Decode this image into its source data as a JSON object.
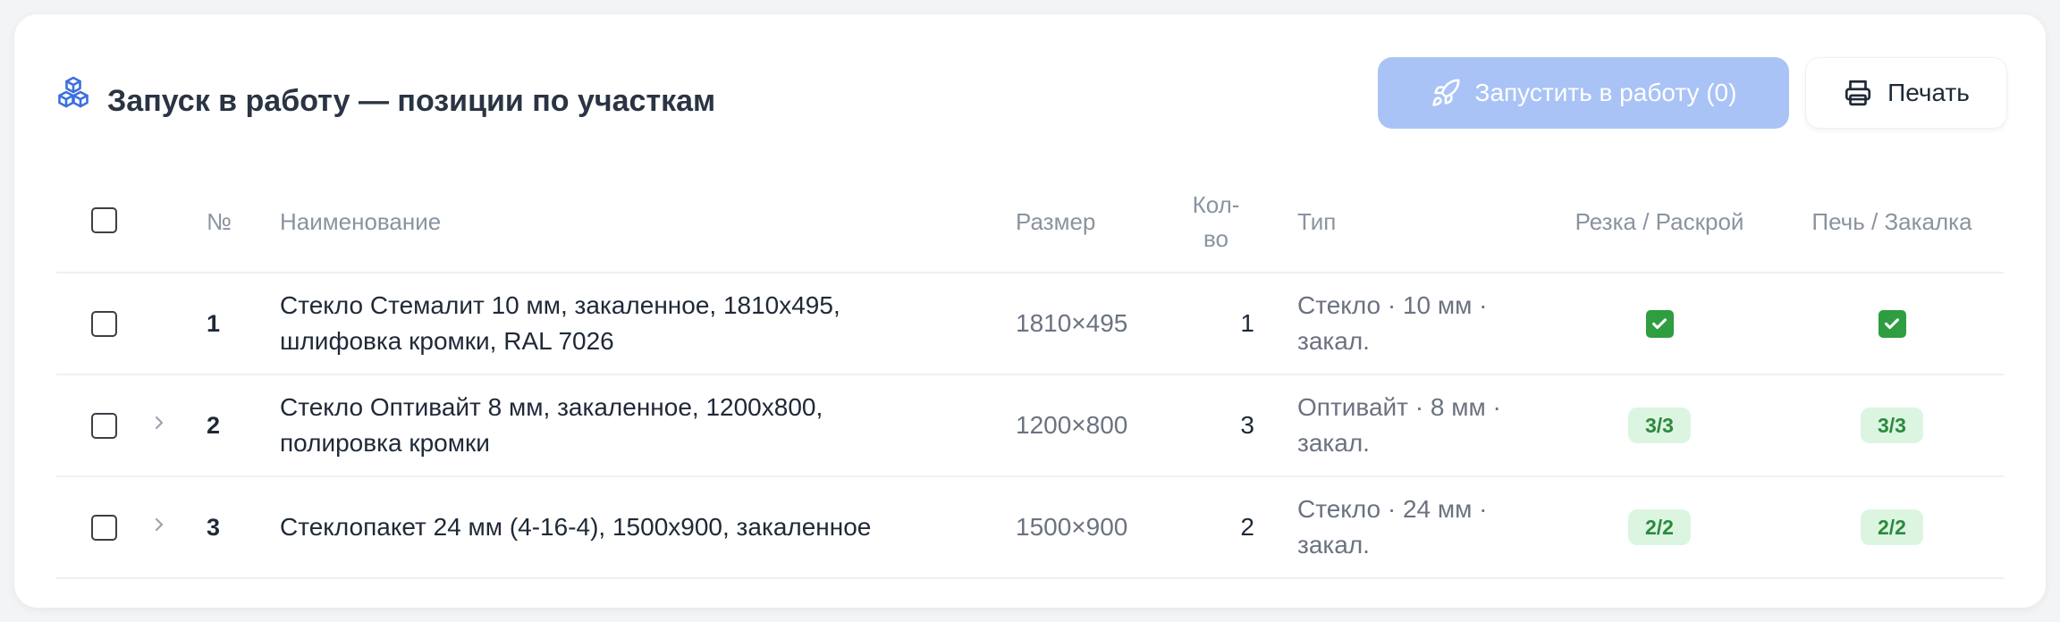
{
  "header": {
    "title": "Запуск в работу — позиции по участкам",
    "launch_label": "Запустить в работу (0)",
    "print_label": "Печать",
    "title_icon": "cubes-icon",
    "launch_icon": "rocket-icon",
    "print_icon": "printer-icon",
    "accent_color": "#3b6fe0",
    "launch_bg": "#a9c3f6"
  },
  "table": {
    "columns": {
      "num": "№",
      "name": "Наименование",
      "size": "Размер",
      "qty": "Кол-во",
      "type": "Тип",
      "cut": "Резка / Раскрой",
      "oven": "Печь / Закалка"
    },
    "rows": [
      {
        "num": "1",
        "name": "Стекло Стемалит 10 мм, закаленное, 1810х495, шлифовка кромки, RAL 7026",
        "size": "1810×495",
        "qty": "1",
        "type": "Стекло · 10 мм · закал.",
        "cut": "done",
        "oven": "done"
      },
      {
        "num": "2",
        "name": "Стекло Оптивайт 8 мм, закаленное, 1200х800, полировка кромки",
        "size": "1200×800",
        "qty": "3",
        "type": "Оптивайт · 8 мм · закал.",
        "cut": "3/3",
        "oven": "3/3"
      },
      {
        "num": "3",
        "name": "Стеклопакет 24 мм (4-16-4), 1500х900, закаленное",
        "size": "1500×900",
        "qty": "2",
        "type": "Стекло · 24 мм · закал.",
        "cut": "2/2",
        "oven": "2/2"
      }
    ]
  }
}
